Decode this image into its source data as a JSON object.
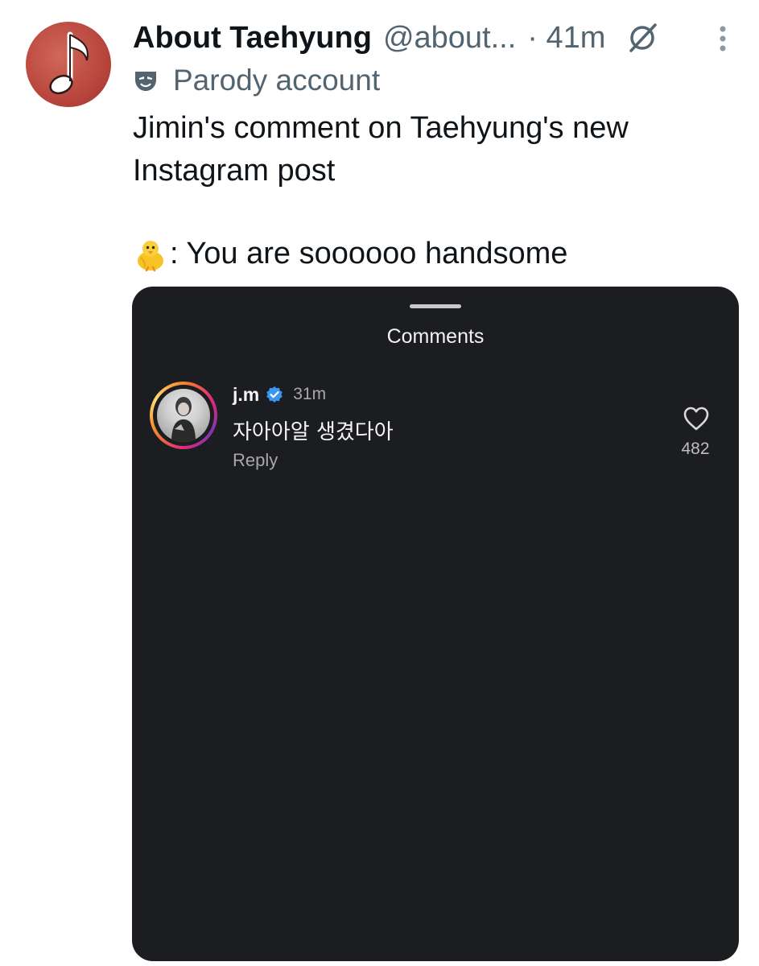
{
  "tweet": {
    "display_name": "About Taehyung",
    "handle": "@about...",
    "time": "· 41m",
    "parody_label": "Parody account",
    "text": "Jimin's comment on Taehyung's new Instagram post",
    "quote_suffix": ": You are soooooo handsome"
  },
  "icons": {
    "avatar": "music-note-avatar",
    "grok": "grok-icon",
    "more": "more-vertical-icon",
    "parody": "mask-icon",
    "emoji": "baby-chick-emoji"
  },
  "instagram": {
    "title": "Comments",
    "comment": {
      "username": "j.m",
      "time": "31m",
      "text": "자아아알 생겼다아",
      "reply_label": "Reply",
      "likes": "482"
    }
  },
  "colors": {
    "secondary_text": "#536471",
    "card_bg": "#1c1d20",
    "verified_blue": "#3897f0"
  }
}
